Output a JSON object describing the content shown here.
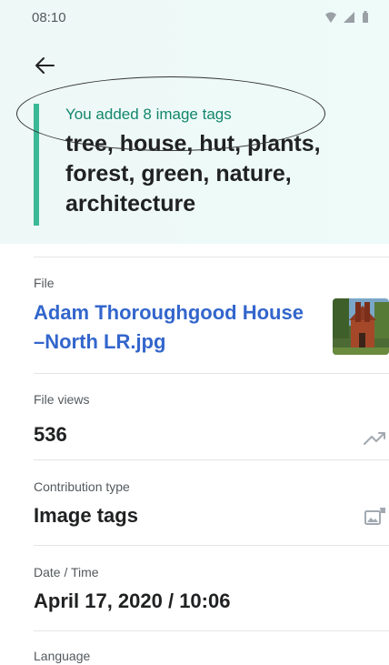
{
  "status_bar": {
    "time": "08:10"
  },
  "header": {
    "back_icon": "arrow-left-icon"
  },
  "summary": {
    "added_label": "You added 8 image tags",
    "tags": "tree, house, hut, plants, forest, green, nature, architecture",
    "accent_color": "#3ab996"
  },
  "file": {
    "label": "File",
    "name": "Adam Thoroughgood House –North LR.jpg",
    "link_color": "#3366cc"
  },
  "file_views": {
    "label": "File views",
    "value": "536",
    "icon": "trending-up-icon"
  },
  "contribution": {
    "label": "Contribution type",
    "value": "Image tags",
    "icon": "image-tag-icon"
  },
  "datetime": {
    "label": "Date / Time",
    "value": "April 17, 2020 / 10:06"
  },
  "language": {
    "label": "Language"
  }
}
